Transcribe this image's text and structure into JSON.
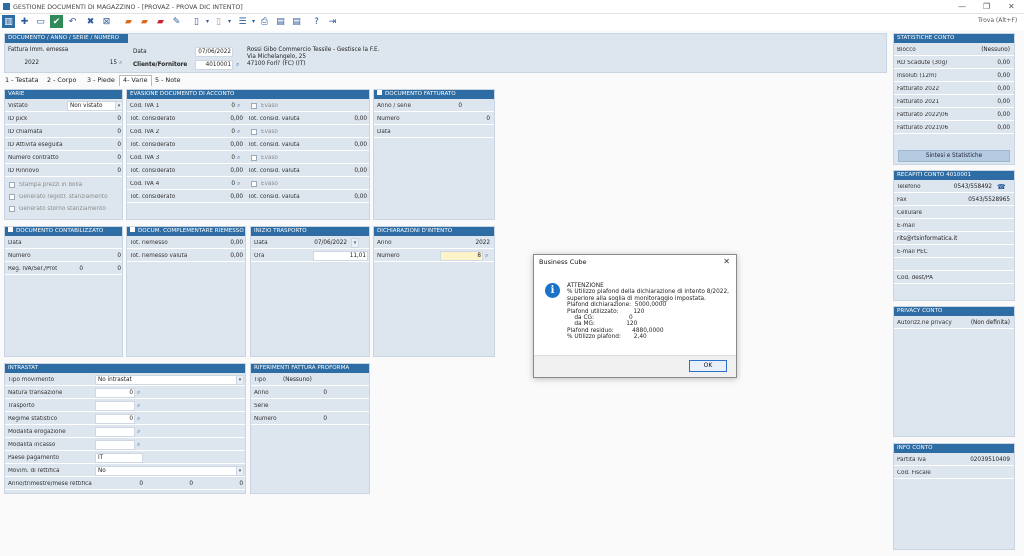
{
  "window": {
    "title": "GESTIONE DOCUMENTI DI MAGAZZINO - [PROVAZ - PROVA DIC INTENTO]",
    "search": "Trova (Alt+F)"
  },
  "doc_header": {
    "title": "DOCUMENTO / ANNO / SERIE / NUMERO",
    "doc_type": "Fattura Imm. emessa",
    "year": "2022",
    "number": "15",
    "date_label": "Data",
    "date": "07/06/2022",
    "customer_label": "Cliente/Fornitore",
    "customer_code": "4010001",
    "customer_name": "Rossi Gibo  Commercio Tessile  - Gestisce la F.E.",
    "customer_address": "Via Michelangelo, 25",
    "customer_city": "47100 Forli' (FC) (IT)"
  },
  "tabs": [
    "1 - Testata",
    "2 - Corpo",
    "3 - Piede",
    "4- Varie",
    "5 - Note"
  ],
  "varie": {
    "title": "VARIE",
    "rows": [
      {
        "label": "Vistato",
        "value": "Non vistato"
      },
      {
        "label": "ID pick",
        "value": "0"
      },
      {
        "label": "ID chiamata",
        "value": "0"
      },
      {
        "label": "ID Attività eseguita",
        "value": "0"
      },
      {
        "label": "Numero contratto",
        "value": "0"
      },
      {
        "label": "ID Rinnovo",
        "value": "0"
      }
    ],
    "checks": [
      "Stampa prezzi in bolla",
      "Generato registr. stanziamento",
      "Generato storno stanziamento"
    ]
  },
  "evasione": {
    "title": "EVASIONE DOCUMENTO DI ACCONTO",
    "groups": [
      {
        "cod": "Cod. IVA 1",
        "cod_val": "0",
        "evaso": "Evaso",
        "tot": "Tot. considerato",
        "tot_val": "0,00",
        "tot2": "Tot. consid. valuta",
        "tot2_val": "0,00"
      },
      {
        "cod": "Cod. IVA 2",
        "cod_val": "0",
        "evaso": "Evaso",
        "tot": "Tot. considerato",
        "tot_val": "0,00",
        "tot2": "Tot. consid. valuta",
        "tot2_val": "0,00"
      },
      {
        "cod": "Cod. IVA 3",
        "cod_val": "0",
        "evaso": "Evaso",
        "tot": "Tot. considerato",
        "tot_val": "0,00",
        "tot2": "Tot. consid. valuta",
        "tot2_val": "0,00"
      },
      {
        "cod": "Cod. IVA 4",
        "cod_val": "0",
        "evaso": "Evaso",
        "tot": "Tot. considerato",
        "tot_val": "0,00",
        "tot2": "Tot. consid. valuta",
        "tot2_val": "0,00"
      }
    ]
  },
  "fatturato": {
    "title": "DOCUMENTO FATTURATO",
    "rows": [
      {
        "label": "Anno / serie",
        "value": "0"
      },
      {
        "label": "Numero",
        "value": "0"
      },
      {
        "label": "Data",
        "value": ""
      }
    ]
  },
  "contabilizzato": {
    "title": "DOCUMENTO CONTABILIZZATO",
    "rows": [
      {
        "label": "Data",
        "value": ""
      },
      {
        "label": "Numero",
        "value": "0"
      },
      {
        "label": "Reg. IVA/Ser./Prot",
        "value": "0",
        "value2": "0"
      }
    ]
  },
  "complementare": {
    "title": "DOCUM. COMPLEMENTARE RIEMESSO",
    "rows": [
      {
        "label": "Tot. riemesso",
        "value": "0,00"
      },
      {
        "label": "Tot. riemesso valuta",
        "value": "0,00"
      }
    ]
  },
  "trasporto": {
    "title": "INIZIO TRASPORTO",
    "rows": [
      {
        "label": "Data",
        "value": "07/06/2022"
      },
      {
        "label": "Ora",
        "value": "11,01"
      }
    ]
  },
  "dichiarazioni": {
    "title": "DICHIARAZIONI D'INTENTO",
    "rows": [
      {
        "label": "Anno",
        "value": "2022"
      },
      {
        "label": "Numero",
        "value": "8"
      }
    ]
  },
  "intrastat": {
    "title": "INTRASTAT",
    "rows": [
      {
        "label": "Tipo movimento",
        "value": "No intrastat"
      },
      {
        "label": "Natura transazione",
        "value": "0"
      },
      {
        "label": "Trasporto",
        "value": ""
      },
      {
        "label": "Regime statistico",
        "value": "0"
      },
      {
        "label": "Modalità erogazione",
        "value": ""
      },
      {
        "label": "Modalità incasso",
        "value": ""
      },
      {
        "label": "Paese pagamento",
        "value": "IT"
      },
      {
        "label": "Movim. di rettifica",
        "value": "No"
      },
      {
        "label": "Anno/trimestre/mese rettifica",
        "v1": "0",
        "v2": "0",
        "v3": "0"
      }
    ]
  },
  "proforma": {
    "title": "RIFERIMENTI FATTURA PROFORMA",
    "rows": [
      {
        "label": "Tipo",
        "value": "(Nessuno)"
      },
      {
        "label": "Anno",
        "value": "0"
      },
      {
        "label": "Serie",
        "value": ""
      },
      {
        "label": "Numero",
        "value": "0"
      }
    ]
  },
  "statistiche": {
    "title": "STATISTICHE CONTO",
    "rows": [
      {
        "label": "Blocco",
        "value": "(Nessuno)"
      },
      {
        "label": "RD Scadute (30g)",
        "value": "0,00"
      },
      {
        "label": "Insoluti (12m)",
        "value": "0,00"
      },
      {
        "label": "Fatturato 2022",
        "value": "0,00"
      },
      {
        "label": "Fatturato 2021",
        "value": "0,00"
      },
      {
        "label": "Fatturato 2022\\06",
        "value": "0,00"
      },
      {
        "label": "Fatturato 2021\\06",
        "value": "0,00"
      }
    ],
    "button": "Sintesi e Statistiche"
  },
  "recapiti": {
    "title": "RECAPITI CONTO 4010001",
    "rows": [
      {
        "label": "Telefono",
        "value": "0543/558492"
      },
      {
        "label": "Fax",
        "value": "0543/5528965"
      },
      {
        "label": "Cellulare",
        "value": ""
      },
      {
        "label": "E-mail",
        "value": ""
      },
      {
        "label": "",
        "value": "rits@rtsinformatica.it"
      },
      {
        "label": "E-mail PEC",
        "value": ""
      },
      {
        "label": "",
        "value": ""
      },
      {
        "label": "Cod. dest/PA",
        "value": ""
      }
    ]
  },
  "privacy": {
    "title": "PRIVACY CONTO",
    "label": "Autorizz.ne privacy",
    "value": "(Non definita)"
  },
  "info": {
    "title": "INFO CONTO",
    "rows": [
      {
        "label": "Partita Iva",
        "value": "02039510409"
      },
      {
        "label": "Cod. Fiscale",
        "value": ""
      }
    ]
  },
  "dialog": {
    "title": "Business Cube",
    "message": "ATTENZIONE\n% Utilizzo plafond della dichiarazione di intento 8/2022,\nsuperiore alla soglia di monitoraggio impostata.\nPlafond dichiarazione:  5000,0000\nPlafond utilizzato:        120\n    da CG:                   0\n    da MG:                 120\nPlafond residuo:          4880,0000\n% Utilizzo plafond:       2,40",
    "ok": "OK"
  }
}
